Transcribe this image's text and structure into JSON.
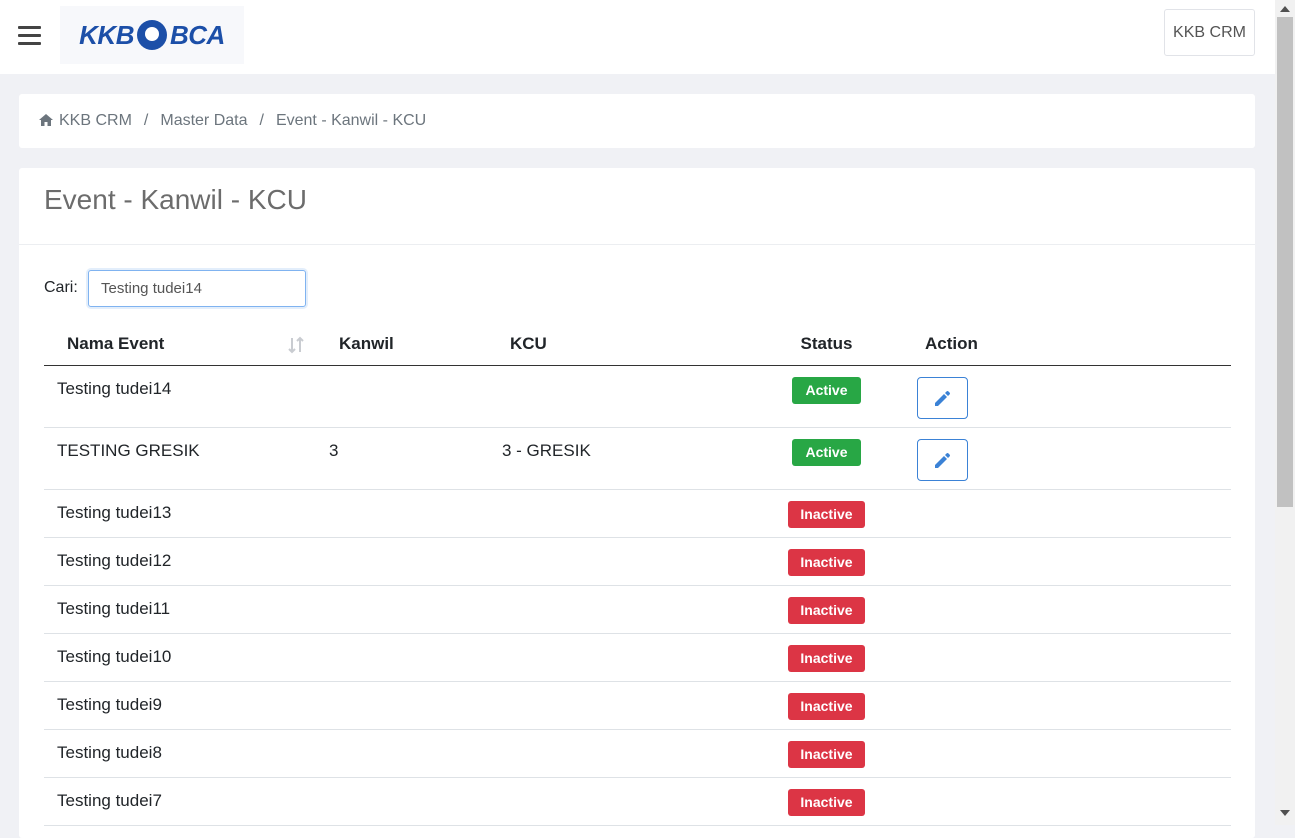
{
  "header": {
    "logo_text_left": "KKB",
    "logo_text_right": "BCA",
    "crm_button_label": "KKB CRM"
  },
  "breadcrumb": {
    "items": [
      "KKB CRM",
      "Master Data",
      "Event - Kanwil - KCU"
    ],
    "separator": "/"
  },
  "page": {
    "title": "Event - Kanwil - KCU"
  },
  "search": {
    "label": "Cari:",
    "value": "Testing tudei14"
  },
  "table": {
    "columns": [
      "Nama Event",
      "Kanwil",
      "KCU",
      "Status",
      "Action"
    ],
    "rows": [
      {
        "name": "Testing tudei14",
        "kanwil": "",
        "kcu": "",
        "status": "Active",
        "editable": true
      },
      {
        "name": "TESTING GRESIK",
        "kanwil": "3",
        "kcu": "3 - GRESIK",
        "status": "Active",
        "editable": true
      },
      {
        "name": "Testing tudei13",
        "kanwil": "",
        "kcu": "",
        "status": "Inactive",
        "editable": false
      },
      {
        "name": "Testing tudei12",
        "kanwil": "",
        "kcu": "",
        "status": "Inactive",
        "editable": false
      },
      {
        "name": "Testing tudei11",
        "kanwil": "",
        "kcu": "",
        "status": "Inactive",
        "editable": false
      },
      {
        "name": "Testing tudei10",
        "kanwil": "",
        "kcu": "",
        "status": "Inactive",
        "editable": false
      },
      {
        "name": "Testing tudei9",
        "kanwil": "",
        "kcu": "",
        "status": "Inactive",
        "editable": false
      },
      {
        "name": "Testing tudei8",
        "kanwil": "",
        "kcu": "",
        "status": "Inactive",
        "editable": false
      },
      {
        "name": "Testing tudei7",
        "kanwil": "",
        "kcu": "",
        "status": "Inactive",
        "editable": false
      }
    ]
  },
  "colors": {
    "active": "#28a745",
    "inactive": "#dc3545",
    "brand": "#1c4fa8",
    "edit_icon": "#3b82d6"
  },
  "icons": {
    "menu": "hamburger-menu-icon",
    "home": "home-icon",
    "sort": "sort-icon",
    "edit": "pencil-icon"
  }
}
